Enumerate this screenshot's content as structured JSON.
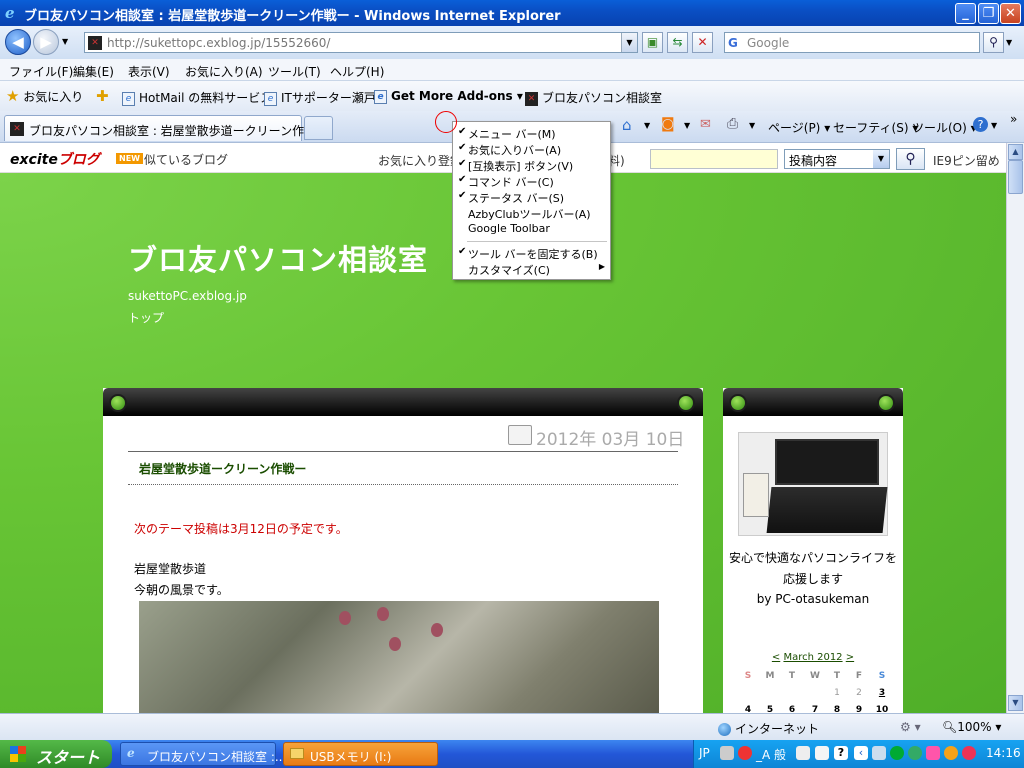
{
  "window": {
    "title": "ブロ友パソコン相談室 : 岩屋堂散歩道ークリーン作戦ー - Windows Internet Explorer",
    "controls": [
      "_",
      "❐",
      "✕"
    ]
  },
  "address": {
    "url": "http://sukettopc.exblog.jp/15552660/",
    "search_placeholder": "Google"
  },
  "menubar": [
    "ファイル(F)",
    "編集(E)",
    "表示(V)",
    "お気に入り(A)",
    "ツール(T)",
    "ヘルプ(H)"
  ],
  "favbar": {
    "favorites": "お気に入り",
    "items": [
      "HotMail の無料サービス",
      "ITサポーター瀬戸",
      "Get More Add-ons",
      "ブロ友パソコン相談室"
    ]
  },
  "tab": {
    "title": "ブロ友パソコン相談室 : 岩屋堂散歩道ークリーン作戦ー"
  },
  "commandbar": {
    "page": "ページ(P)",
    "safety": "セーフティ(S)",
    "tools": "ツール(O)"
  },
  "context_menu": {
    "items": [
      {
        "label": "メニュー バー(M)",
        "checked": true
      },
      {
        "label": "お気に入りバー(A)",
        "checked": true
      },
      {
        "label": "[互換表示] ボタン(V)",
        "checked": true
      },
      {
        "label": "コマンド バー(C)",
        "checked": true
      },
      {
        "label": "ステータス バー(S)",
        "checked": true
      },
      {
        "label": "AzbyClubツールバー(A)",
        "checked": false
      },
      {
        "label": "Google Toolbar",
        "checked": false
      }
    ],
    "items2": [
      {
        "label": "ツール バーを固定する(B)",
        "checked": true
      },
      {
        "label": "カスタマイズ(C)",
        "checked": false,
        "submenu": true
      }
    ]
  },
  "excite": {
    "logo_a": "excite",
    "logo_b": "ブログ",
    "new_badge": "NEW",
    "similar": "似ているブログ",
    "fav_reg": "お気に入り登録",
    "muryou": "料)",
    "select_value": "投稿内容",
    "ie9": "IE9ピン留め"
  },
  "blog": {
    "title": "ブロ友パソコン相談室",
    "url": "sukettoPC.exblog.jp",
    "top": "トップ"
  },
  "post": {
    "date": "2012年 03月 10日",
    "title": "岩屋堂散歩道ークリーン作戦ー",
    "notice": "次のテーマ投稿は3月12日の予定です。",
    "line1": "岩屋堂散歩道",
    "line2": "今朝の風景です。"
  },
  "sidebar": {
    "text1": "安心で快適なパソコンライフを",
    "text2": "応援します",
    "text3": "by PC-otasukeman",
    "cal_prev": "<",
    "cal_month": "March 2012",
    "cal_next": ">",
    "weekdays": [
      "S",
      "M",
      "T",
      "W",
      "T",
      "F",
      "S"
    ],
    "row1": [
      "",
      "",
      "",
      "",
      "1",
      "2",
      "3"
    ],
    "row2": [
      "4",
      "5",
      "6",
      "7",
      "8",
      "9",
      "10"
    ]
  },
  "status": {
    "zone": "インターネット",
    "zoom": "100%"
  },
  "taskbar": {
    "start": "スタート",
    "task1": "ブロ友パソコン相談室 :...",
    "task2": "USBメモリ (I:)",
    "ime": "JP",
    "ime_mode": "_A 般",
    "clock": "14:16"
  },
  "colors": {
    "blog_green": "#68c535",
    "title_blue": "#0a4fc4",
    "notice_red": "#cc0000",
    "taskbar_blue": "#2357d8",
    "start_green": "#3c9e34"
  }
}
